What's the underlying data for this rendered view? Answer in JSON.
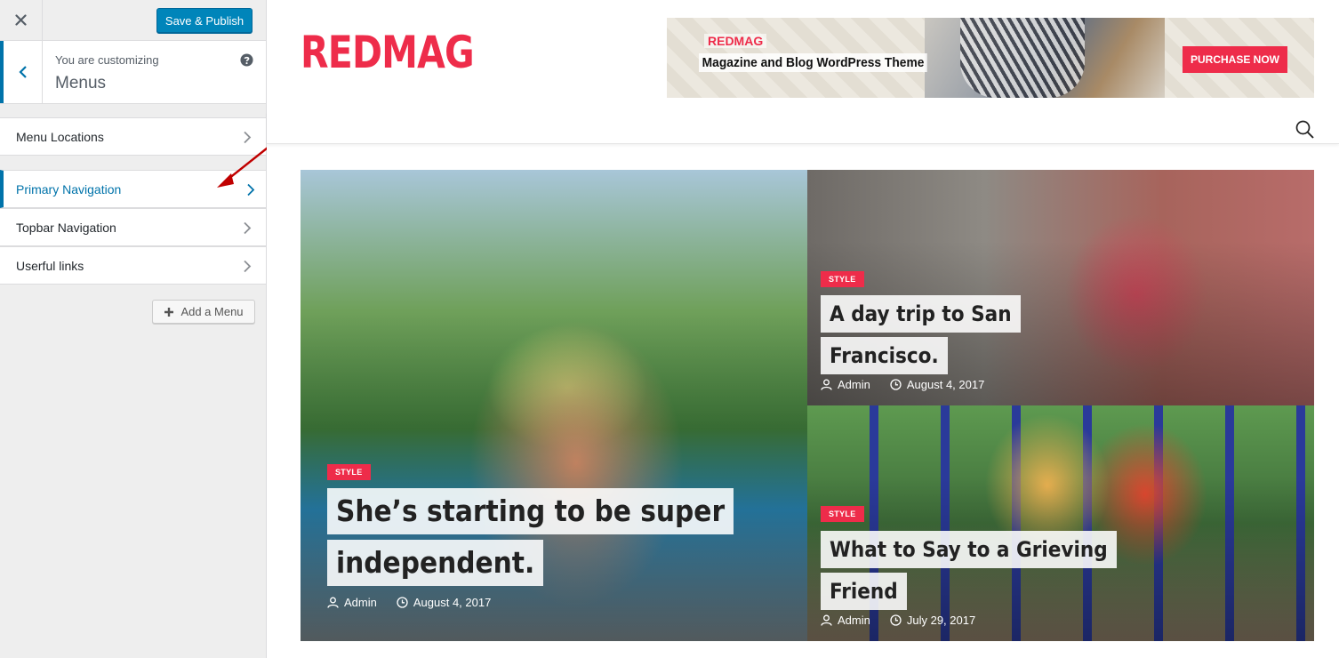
{
  "customizer": {
    "publish_label": "Save & Publish",
    "customizing_label": "You are customizing",
    "section_title": "Menus",
    "menu_items": [
      {
        "label": "Menu Locations"
      },
      {
        "label": "Primary Navigation"
      },
      {
        "label": "Topbar Navigation"
      },
      {
        "label": "Userful links"
      }
    ],
    "add_menu_label": "Add a Menu",
    "accent_color": "#0073aa",
    "button_color": "#0085ba"
  },
  "site": {
    "logo": "REDMAG",
    "brand_color": "#ee2c4a",
    "banner": {
      "brand": "REDMAG",
      "tagline": "Magazine and Blog WordPress Theme",
      "cta": "PURCHASE NOW"
    },
    "posts": [
      {
        "category": "STYLE",
        "title_lines": [
          "She’s starting to be super",
          "independent."
        ],
        "author": "Admin",
        "date": "August 4, 2017"
      },
      {
        "category": "STYLE",
        "title_lines": [
          "A day trip to San",
          "Francisco."
        ],
        "author": "Admin",
        "date": "August 4, 2017"
      },
      {
        "category": "STYLE",
        "title_lines": [
          "What to Say to a Grieving",
          "Friend"
        ],
        "author": "Admin",
        "date": "July 29, 2017"
      }
    ]
  }
}
